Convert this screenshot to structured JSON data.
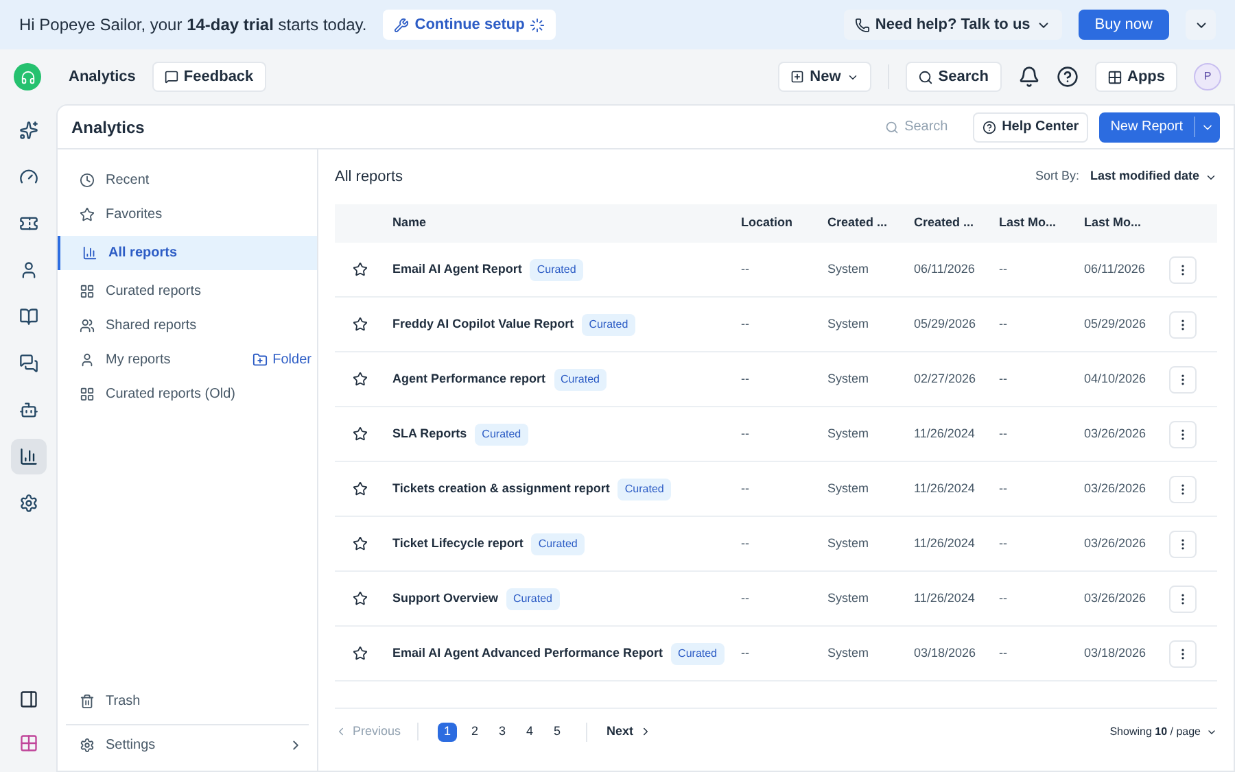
{
  "banner": {
    "greeting": "Hi Popeye Sailor, your **14-day trial** starts today.",
    "setup_button": "Continue setup",
    "help_button": "Need help? Talk to us",
    "buy_button": "Buy now"
  },
  "header": {
    "title": "Analytics",
    "feedback": "Feedback",
    "new_button": "New",
    "search_button": "Search",
    "apps_button": "Apps",
    "avatar": "P"
  },
  "rail": [
    {
      "kind": "sparkle",
      "selected": false
    },
    {
      "kind": "gauge",
      "selected": false
    },
    {
      "kind": "ticket",
      "selected": false
    },
    {
      "kind": "user",
      "selected": false
    },
    {
      "kind": "book",
      "selected": false
    },
    {
      "kind": "chat",
      "selected": false
    },
    {
      "kind": "bot",
      "selected": false
    },
    {
      "kind": "chart",
      "selected": true
    },
    {
      "kind": "gear",
      "selected": false
    }
  ],
  "page": {
    "title": "Analytics",
    "search_placeholder": "Search",
    "help_button": "Help Center",
    "new_report_button": "New Report"
  },
  "sidebar": {
    "items": [
      {
        "label": "Recent",
        "kind": "clock",
        "selected": false
      },
      {
        "label": "Favorites",
        "kind": "star",
        "selected": false
      },
      {
        "label": "All reports",
        "kind": "chart",
        "selected": true
      },
      {
        "label": "Curated reports",
        "kind": "grid",
        "selected": false
      },
      {
        "label": "Shared reports",
        "kind": "users",
        "selected": false
      },
      {
        "label": "My reports",
        "kind": "user",
        "selected": false,
        "action": "Folder"
      },
      {
        "label": "Curated reports (Old)",
        "kind": "grid",
        "selected": false
      }
    ],
    "trash": "Trash",
    "settings": "Settings"
  },
  "table": {
    "title": "All reports",
    "sort_label": "Sort By:",
    "sort_value": "Last modified date",
    "columns": [
      "Name",
      "Location",
      "Created ...",
      "Created ...",
      "Last Mo...",
      "Last Mo..."
    ],
    "rows": [
      {
        "name": "Email AI Agent Report",
        "tag": "Curated",
        "location": "--",
        "created_by": "System",
        "created_on": "06/11/2026",
        "modified_by": "--",
        "modified_on": "06/11/2026"
      },
      {
        "name": "Freddy AI Copilot Value Report",
        "tag": "Curated",
        "location": "--",
        "created_by": "System",
        "created_on": "05/29/2026",
        "modified_by": "--",
        "modified_on": "05/29/2026"
      },
      {
        "name": "Agent Performance report",
        "tag": "Curated",
        "location": "--",
        "created_by": "System",
        "created_on": "02/27/2026",
        "modified_by": "--",
        "modified_on": "04/10/2026"
      },
      {
        "name": "SLA Reports",
        "tag": "Curated",
        "location": "--",
        "created_by": "System",
        "created_on": "11/26/2024",
        "modified_by": "--",
        "modified_on": "03/26/2026"
      },
      {
        "name": "Tickets creation & assignment report",
        "tag": "Curated",
        "location": "--",
        "created_by": "System",
        "created_on": "11/26/2024",
        "modified_by": "--",
        "modified_on": "03/26/2026"
      },
      {
        "name": "Ticket Lifecycle report",
        "tag": "Curated",
        "location": "--",
        "created_by": "System",
        "created_on": "11/26/2024",
        "modified_by": "--",
        "modified_on": "03/26/2026"
      },
      {
        "name": "Support Overview",
        "tag": "Curated",
        "location": "--",
        "created_by": "System",
        "created_on": "11/26/2024",
        "modified_by": "--",
        "modified_on": "03/26/2026"
      },
      {
        "name": "Email AI Agent Advanced Performance Report",
        "tag": "Curated",
        "location": "--",
        "created_by": "System",
        "created_on": "03/18/2026",
        "modified_by": "--",
        "modified_on": "03/18/2026"
      }
    ]
  },
  "pagination": {
    "previous": "Previous",
    "previous_disabled": true,
    "pages": [
      {
        "label": "1",
        "selected": true
      },
      {
        "label": "2",
        "selected": false
      },
      {
        "label": "3",
        "selected": false
      },
      {
        "label": "4",
        "selected": false
      },
      {
        "label": "5",
        "selected": false
      }
    ],
    "next": "Next",
    "showing": "Showing **10** / page"
  }
}
